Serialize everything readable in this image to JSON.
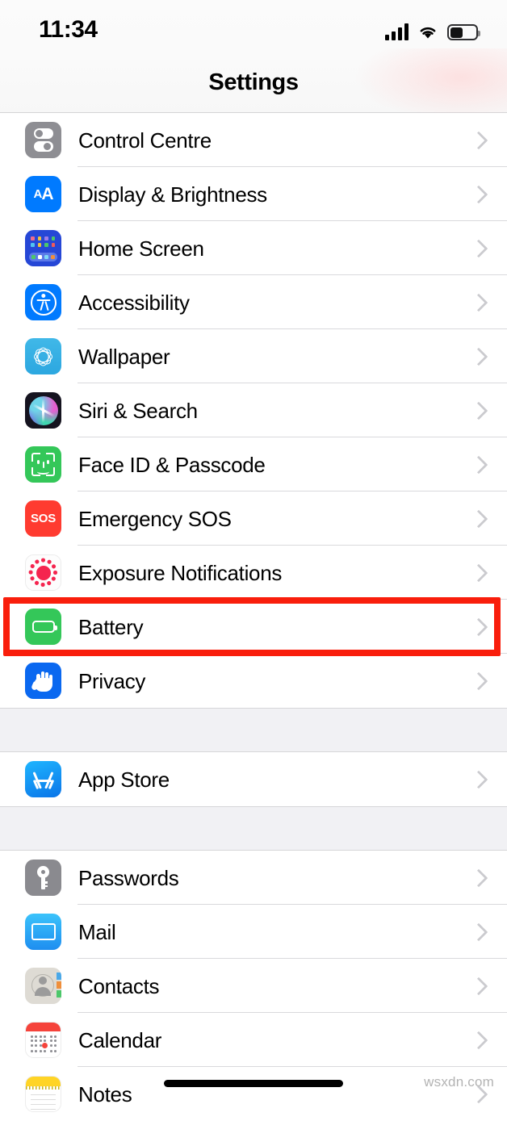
{
  "status_bar": {
    "time": "11:34",
    "signal_icon": "cellular-signal-icon",
    "signal_bars": 4,
    "wifi_icon": "wifi-icon",
    "battery_icon": "battery-icon",
    "battery_level_percent": 45
  },
  "nav": {
    "title": "Settings"
  },
  "groups": [
    {
      "rows": [
        {
          "label": "Control Centre",
          "icon": "control-centre-icon",
          "icon_color": "#8e8e93"
        },
        {
          "label": "Display & Brightness",
          "icon": "display-brightness-icon",
          "icon_color": "#007aff"
        },
        {
          "label": "Home Screen",
          "icon": "home-screen-icon",
          "icon_color": "#2647d6"
        },
        {
          "label": "Accessibility",
          "icon": "accessibility-icon",
          "icon_color": "#007aff"
        },
        {
          "label": "Wallpaper",
          "icon": "wallpaper-icon",
          "icon_color": "#2ca7e0"
        },
        {
          "label": "Siri & Search",
          "icon": "siri-search-icon",
          "icon_color": "#15131f"
        },
        {
          "label": "Face ID & Passcode",
          "icon": "face-id-icon",
          "icon_color": "#34c759"
        },
        {
          "label": "Emergency SOS",
          "icon": "emergency-sos-icon",
          "icon_color": "#ff3b30"
        },
        {
          "label": "Exposure Notifications",
          "icon": "exposure-notifications-icon",
          "icon_color": "#f5254f"
        },
        {
          "label": "Battery",
          "icon": "battery-settings-icon",
          "icon_color": "#34c759"
        },
        {
          "label": "Privacy",
          "icon": "privacy-icon",
          "icon_color": "#0a68f0"
        }
      ]
    },
    {
      "rows": [
        {
          "label": "App Store",
          "icon": "app-store-icon",
          "icon_color": "#0a74e8"
        }
      ]
    },
    {
      "rows": [
        {
          "label": "Passwords",
          "icon": "passwords-key-icon",
          "icon_color": "#8a8a8f"
        },
        {
          "label": "Mail",
          "icon": "mail-icon",
          "icon_color": "#1e8ef0"
        },
        {
          "label": "Contacts",
          "icon": "contacts-icon",
          "icon_color": "#dedbd4"
        },
        {
          "label": "Calendar",
          "icon": "calendar-icon",
          "icon_color": "#f5433b"
        },
        {
          "label": "Notes",
          "icon": "notes-icon",
          "icon_color": "#ffd426"
        }
      ]
    }
  ],
  "annotation": {
    "highlight_label": "Battery",
    "color": "#f91e0c"
  },
  "watermark": {
    "text": "wsxdn.com"
  },
  "chevron_icon": "chevron-right-icon"
}
